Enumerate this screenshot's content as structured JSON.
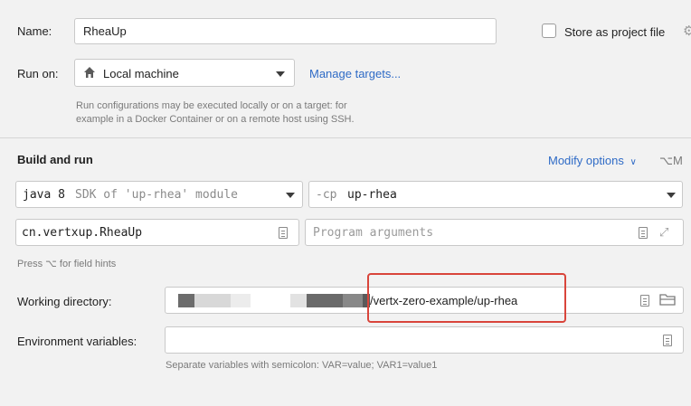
{
  "name": {
    "label": "Name:",
    "value": "RheaUp"
  },
  "store": {
    "label": "Store as project file",
    "checked": false
  },
  "run_on": {
    "label": "Run on:",
    "value": "Local machine",
    "manage_label": "Manage targets...",
    "hint": [
      "Run configurations may be executed locally or on a target: for",
      "example in a Docker Container or on a remote host using SSH."
    ]
  },
  "build": {
    "title": "Build and run",
    "modify_label": "Modify options",
    "modify_shortcut": "⌥M",
    "sdk": {
      "main": "java 8",
      "secondary": "SDK of 'up-rhea' module"
    },
    "cp": {
      "flag": "-cp",
      "value": "up-rhea"
    },
    "main_class": "cn.vertxup.RheaUp",
    "program_args_placeholder": "Program arguments",
    "field_hint": "Press ⌥ for field hints"
  },
  "working_dir": {
    "label": "Working directory:",
    "value": "/vertx-zero-example/up-rhea"
  },
  "env": {
    "label": "Environment variables:",
    "value": "",
    "hint": "Separate variables with semicolon: VAR=value; VAR1=value1"
  },
  "colors": {
    "accent": "#2f6bc6",
    "highlight_border": "#d9453b"
  }
}
